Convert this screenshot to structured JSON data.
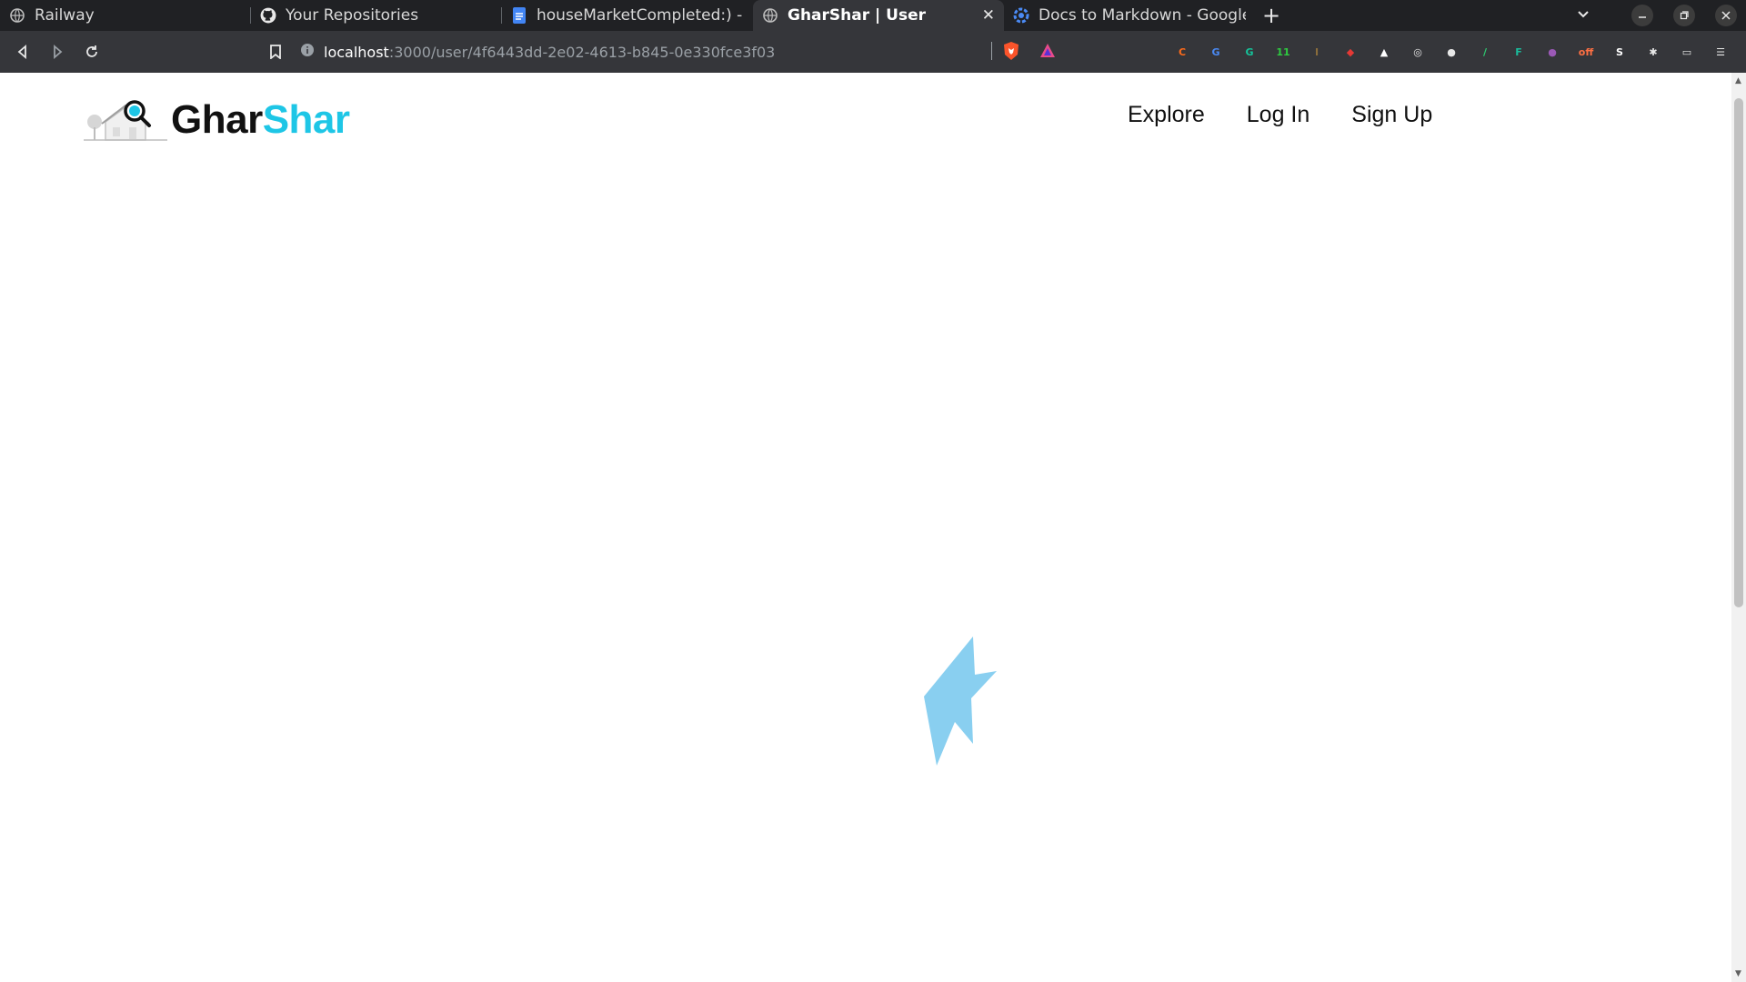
{
  "browser": {
    "tabs": [
      {
        "title": "Railway",
        "icon": "globe-icon"
      },
      {
        "title": "Your Repositories",
        "icon": "github-icon"
      },
      {
        "title": "houseMarketCompleted:) - Gc",
        "icon": "google-docs-icon"
      },
      {
        "title": "GharShar | User",
        "icon": "globe-icon",
        "active": true
      },
      {
        "title": "Docs to Markdown - Google W",
        "icon": "extension-icon"
      }
    ],
    "new_tab_label": "+",
    "close_label": "✕",
    "url": {
      "host": "localhost",
      "rest": ":3000/user/4f6443dd-2e02-4613-b845-0e330fce3f03"
    },
    "extensions": [
      {
        "name": "extension-c-icon",
        "glyph": "C",
        "color": "#ff6b1a"
      },
      {
        "name": "extension-translate-icon",
        "glyph": "G",
        "color": "#4a8af4"
      },
      {
        "name": "grammarly-icon",
        "glyph": "G",
        "color": "#15c39a"
      },
      {
        "name": "clock-extension-icon",
        "glyph": "11",
        "color": "#2ecc40"
      },
      {
        "name": "extension-tool-icon",
        "glyph": "I",
        "color": "#8a6d3b"
      },
      {
        "name": "extension-red-icon",
        "glyph": "◆",
        "color": "#e53935"
      },
      {
        "name": "extension-dark-icon",
        "glyph": "▲",
        "color": "#ffffff"
      },
      {
        "name": "extension-target-icon",
        "glyph": "◎",
        "color": "#e8e8e8"
      },
      {
        "name": "extension-circle-icon",
        "glyph": "●",
        "color": "#e8e8e8"
      },
      {
        "name": "extension-green-icon",
        "glyph": "/",
        "color": "#2ecc71"
      },
      {
        "name": "extension-teal-icon",
        "glyph": "F",
        "color": "#1abc9c"
      },
      {
        "name": "extension-purple-icon",
        "glyph": "●",
        "color": "#9b59b6"
      },
      {
        "name": "extension-off-icon",
        "glyph": "off",
        "color": "#ff7043"
      },
      {
        "name": "extension-s-icon",
        "glyph": "S",
        "color": "#ffffff"
      },
      {
        "name": "extensions-puzzle-icon",
        "glyph": "✱",
        "color": "#e8e8e8"
      },
      {
        "name": "wallet-icon",
        "glyph": "▭",
        "color": "#e8e8e8"
      },
      {
        "name": "menu-icon",
        "glyph": "☰",
        "color": "#e8e8e8"
      }
    ]
  },
  "site": {
    "brand": {
      "part1": "Ghar",
      "part2": "Shar"
    },
    "nav": [
      "Explore",
      "Log In",
      "Sign Up"
    ]
  },
  "colors": {
    "brand_accent": "#1ec6e6",
    "loader": "#89cff0"
  }
}
